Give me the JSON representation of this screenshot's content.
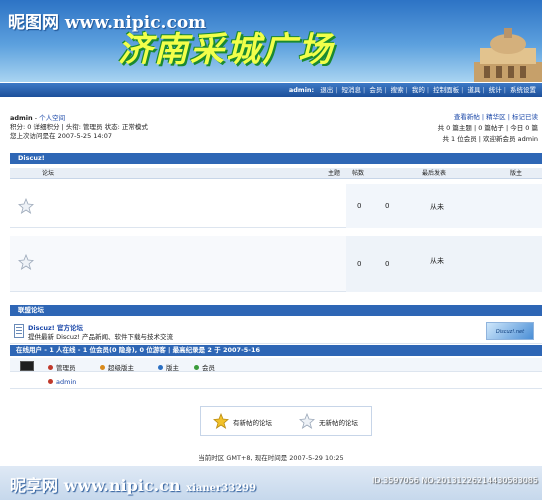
{
  "watermark": {
    "top": "昵图网 www.nipic.com",
    "bottom_left": "昵享网 www.nipic.cn",
    "bottom_user": "xianer33299",
    "bottom_id": "ID:3597056 NO:20131226214430583085"
  },
  "banner": {
    "title": "济南采城广场"
  },
  "nav": {
    "items": [
      "admin:",
      "退出",
      "短消息",
      "会员",
      "搜索",
      "我的",
      "控制面板",
      "道具",
      "统计",
      "系统设置"
    ]
  },
  "user": {
    "name": "admin",
    "space_link": "个人空间",
    "line2": "积分: 0 详细积分 | 头衔: 管理员 状态: 正常模式",
    "line3": "您上次访问是在 2007-5-25 14:07"
  },
  "right_info": {
    "links": "查看新帖 | 精华区 | 标记已读",
    "stats1": "共 0 篇主题 | 0 篇帖子 | 今日 0 篇",
    "stats2": "共 1 位会员 | 欢迎新会员 admin"
  },
  "forum": {
    "section_title": "Discuz!",
    "col_forum": "论坛",
    "col_topics": "主题",
    "col_posts": "帖数",
    "col_last": "最后发表",
    "col_mod": "版主",
    "rows": [
      {
        "topics": "0",
        "posts": "0",
        "last": "从未"
      },
      {
        "topics": "0",
        "posts": "0",
        "last": "从未"
      }
    ]
  },
  "links_section": {
    "title": "联盟论坛",
    "item_title": "Discuz! 官方论坛",
    "item_desc": "提供最新 Discuz! 产品新闻、软件下载与技术交流",
    "banner_text": "Discuz!.net"
  },
  "online": {
    "header": "在线用户 - 1 人在线 - 1 位会员(0 隐身), 0 位游客 | 最高纪录是 2 于 2007-5-16",
    "legend": [
      "管理员",
      "超级版主",
      "版主",
      "会员"
    ],
    "legend_colors": [
      "#c0392b",
      "#d98a1b",
      "#2b6fc2",
      "#3a9b3a"
    ],
    "users": [
      "admin"
    ]
  },
  "icons_box": {
    "new_label": "有新帖的论坛",
    "none_label": "无新帖的论坛"
  },
  "footer": {
    "time": "当前时区 GMT+8, 现在时间是 2007-5-29 10:25"
  }
}
